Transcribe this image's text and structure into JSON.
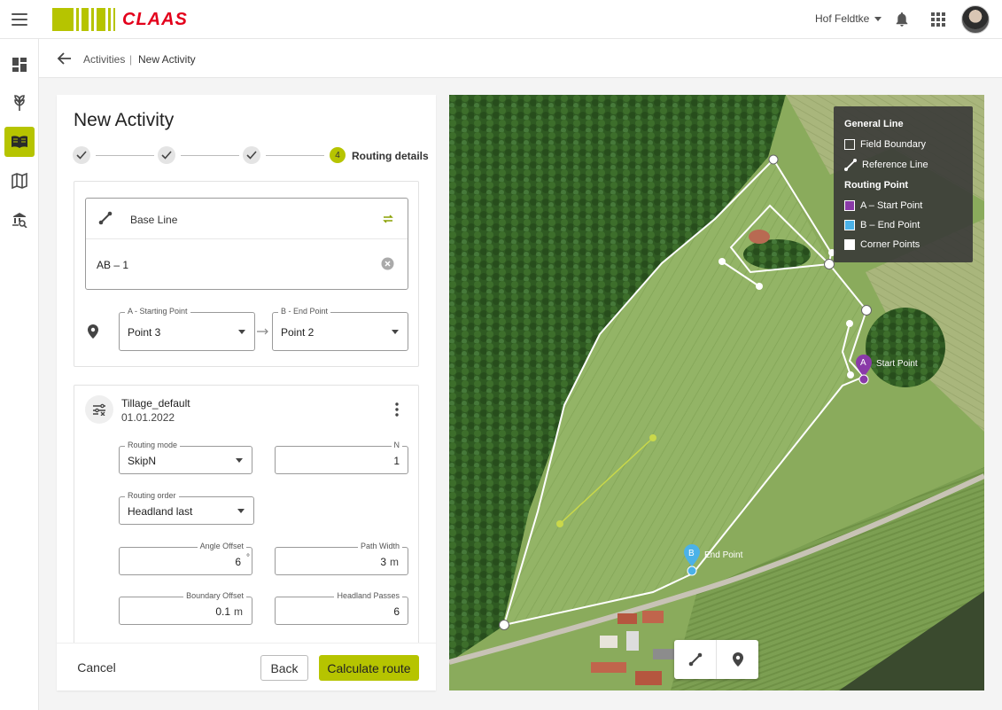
{
  "brand": {
    "name": "CLAAS",
    "stripe_color": "#b6c400",
    "accent_red": "#e3001b"
  },
  "header": {
    "farm": "Hof Feldtke"
  },
  "breadcrumb": {
    "parent": "Activities",
    "separator": "|",
    "current": "New Activity"
  },
  "panel": {
    "title": "New Activity",
    "steps": {
      "current_number": "4",
      "current_label": "Routing details"
    },
    "base_line": {
      "label": "Base Line",
      "value": "AB – 1"
    },
    "points": {
      "a_label": "A - Starting Point",
      "a_value": "Point 3",
      "b_label": "B - End Point",
      "b_value": "Point 2"
    },
    "profile": {
      "name": "Tillage_default",
      "date": "01.01.2022",
      "routing_mode_label": "Routing mode",
      "routing_mode_value": "SkipN",
      "n_label": "N",
      "n_value": "1",
      "routing_order_label": "Routing order",
      "routing_order_value": "Headland last",
      "angle_offset_label": "Angle Offset",
      "angle_offset_value": "6",
      "angle_offset_unit": "°",
      "path_width_label": "Path Width",
      "path_width_value": "3",
      "path_width_unit": "m",
      "boundary_offset_label": "Boundary Offset",
      "boundary_offset_value": "0.1",
      "boundary_offset_unit": "m",
      "headland_passes_label": "Headland Passes",
      "headland_passes_value": "6"
    },
    "actions": {
      "cancel": "Cancel",
      "back": "Back",
      "calculate": "Calculate route"
    }
  },
  "map": {
    "legend": {
      "general_title": "General Line",
      "field_boundary": "Field Boundary",
      "reference_line": "Reference Line",
      "routing_title": "Routing Point",
      "start_point": "A – Start Point",
      "end_point": "B – End Point",
      "corner_points": "Corner Points",
      "start_color": "#8a3aa8",
      "end_color": "#4bb2e8"
    },
    "start_marker": "A",
    "start_text": "Start Point",
    "end_marker": "B",
    "end_text": "End Point"
  }
}
